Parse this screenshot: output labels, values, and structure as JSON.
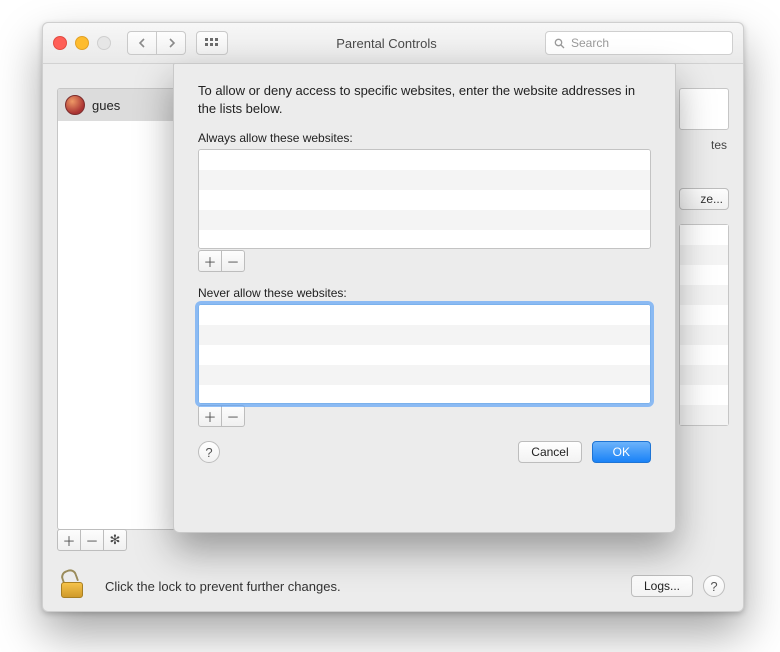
{
  "window": {
    "title": "Parental Controls",
    "search_placeholder": "Search"
  },
  "sidebar": {
    "user": "gues"
  },
  "right_peek": {
    "label1": "tes",
    "customize": "ze..."
  },
  "bottom": {
    "lock_text": "Click the lock to prevent further changes.",
    "logs": "Logs..."
  },
  "sheet": {
    "intro": "To allow or deny access to specific websites, enter the website addresses in the lists below.",
    "allow_label": "Always allow these websites:",
    "deny_label": "Never allow these websites:",
    "cancel": "Cancel",
    "ok": "OK"
  },
  "glyphs": {
    "plus": "＋",
    "minus": "－",
    "gear": "✻",
    "help": "?"
  }
}
